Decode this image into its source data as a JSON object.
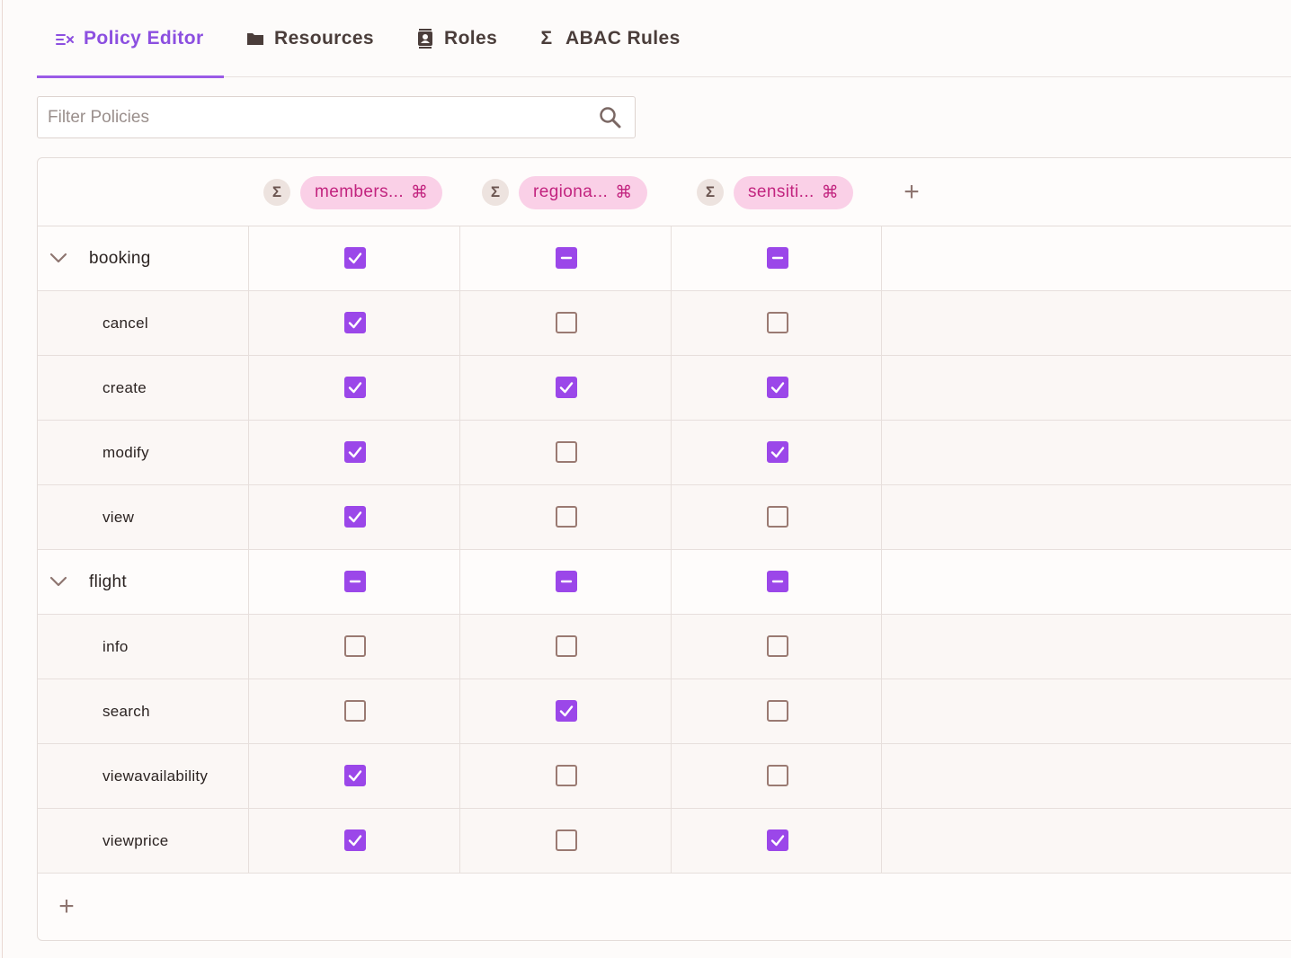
{
  "tabs": [
    {
      "label": "Policy Editor",
      "icon": "policy-icon",
      "active": true
    },
    {
      "label": "Resources",
      "icon": "folder-icon",
      "active": false
    },
    {
      "label": "Roles",
      "icon": "contact-card-icon",
      "active": false
    },
    {
      "label": "ABAC Rules",
      "icon": "sigma-icon",
      "active": false
    }
  ],
  "filter": {
    "placeholder": "Filter Policies",
    "value": ""
  },
  "rules": [
    {
      "label": "members...",
      "icon": "sigma-icon"
    },
    {
      "label": "regiona...",
      "icon": "sigma-icon"
    },
    {
      "label": "sensiti...",
      "icon": "sigma-icon"
    }
  ],
  "glyphs": {
    "sigma": "Σ",
    "cmd": "⌘",
    "plus": "+"
  },
  "colors": {
    "accent": "#9b47e9",
    "chip_bg": "#fad0e7",
    "chip_text": "#c2247f"
  },
  "resources": [
    {
      "name": "booking",
      "group_state": [
        "checked",
        "partial",
        "partial"
      ],
      "actions": [
        {
          "name": "cancel",
          "states": [
            "checked",
            "unchecked",
            "unchecked"
          ]
        },
        {
          "name": "create",
          "states": [
            "checked",
            "checked",
            "checked"
          ]
        },
        {
          "name": "modify",
          "states": [
            "checked",
            "unchecked",
            "checked"
          ]
        },
        {
          "name": "view",
          "states": [
            "checked",
            "unchecked",
            "unchecked"
          ]
        }
      ]
    },
    {
      "name": "flight",
      "group_state": [
        "partial",
        "partial",
        "partial"
      ],
      "actions": [
        {
          "name": "info",
          "states": [
            "unchecked",
            "unchecked",
            "unchecked"
          ]
        },
        {
          "name": "search",
          "states": [
            "unchecked",
            "checked",
            "unchecked"
          ]
        },
        {
          "name": "viewavailability",
          "states": [
            "checked",
            "unchecked",
            "unchecked"
          ]
        },
        {
          "name": "viewprice",
          "states": [
            "checked",
            "unchecked",
            "checked"
          ]
        }
      ]
    }
  ]
}
